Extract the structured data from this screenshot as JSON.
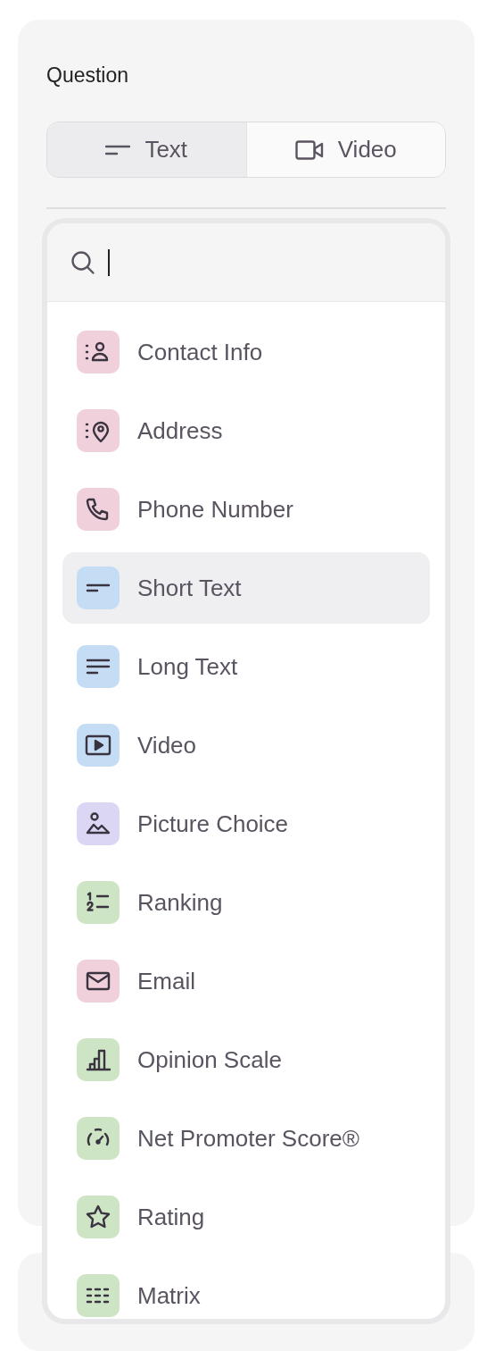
{
  "title": "Question",
  "tabs": [
    {
      "label": "Text",
      "kind": "text",
      "selected": true
    },
    {
      "label": "Video",
      "kind": "video",
      "selected": false
    }
  ],
  "question_types": [
    {
      "label": "Contact Info",
      "kind": "contact",
      "color": "#f0d0da",
      "selected": false
    },
    {
      "label": "Address",
      "kind": "address",
      "color": "#f0d0da",
      "selected": false
    },
    {
      "label": "Phone Number",
      "kind": "phone",
      "color": "#f0d0da",
      "selected": false
    },
    {
      "label": "Short Text",
      "kind": "short",
      "color": "#c5ddf4",
      "selected": true
    },
    {
      "label": "Long Text",
      "kind": "long",
      "color": "#c5ddf4",
      "selected": false
    },
    {
      "label": "Video",
      "kind": "video",
      "color": "#c5ddf4",
      "selected": false
    },
    {
      "label": "Picture Choice",
      "kind": "picture",
      "color": "#dcd6f5",
      "selected": false
    },
    {
      "label": "Ranking",
      "kind": "ranking",
      "color": "#cde5c5",
      "selected": false
    },
    {
      "label": "Email",
      "kind": "email",
      "color": "#f0d0da",
      "selected": false
    },
    {
      "label": "Opinion Scale",
      "kind": "scale",
      "color": "#cde5c5",
      "selected": false
    },
    {
      "label": "Net Promoter Score®",
      "kind": "nps",
      "color": "#cde5c5",
      "selected": false
    },
    {
      "label": "Rating",
      "kind": "rating",
      "color": "#cde5c5",
      "selected": false
    },
    {
      "label": "Matrix",
      "kind": "matrix",
      "color": "#cde5c5",
      "selected": false
    }
  ]
}
